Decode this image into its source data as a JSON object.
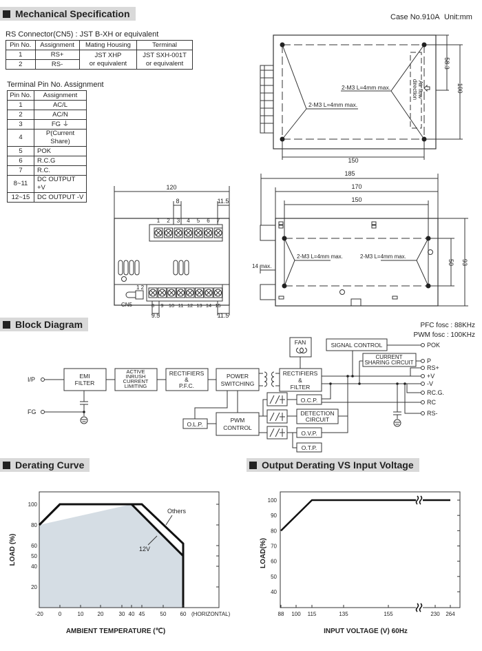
{
  "headings": {
    "mechanical": "Mechanical Specification",
    "block": "Block Diagram",
    "derating": "Derating Curve",
    "output_derating": "Output Derating VS Input Voltage"
  },
  "case_info": {
    "case_no": "Case No.910A",
    "unit": "Unit:mm"
  },
  "rs_connector": {
    "title": "RS Connector(CN5) : JST B-XH or equivalent",
    "headers": [
      "Pin No.",
      "Assignment",
      "Mating Housing",
      "Terminal"
    ],
    "rows": [
      [
        "1",
        "RS+"
      ],
      [
        "2",
        "RS-"
      ]
    ],
    "housing": [
      "JST XHP",
      "or equivalent"
    ],
    "terminal": [
      "JST SXH-001T",
      "or equivalent"
    ]
  },
  "terminal_pins": {
    "title": "Terminal Pin No.  Assignment",
    "headers": [
      "Pin No.",
      "Assignment"
    ],
    "rows": [
      [
        "1",
        "AC/L"
      ],
      [
        "2",
        "AC/N"
      ],
      [
        "3",
        "FG ⏚"
      ],
      [
        "4",
        "P(Current Share)"
      ],
      [
        "5",
        "POK"
      ],
      [
        "6",
        "R.C.G"
      ],
      [
        "7",
        "R.C."
      ],
      [
        "8~11",
        "DC OUTPUT +V"
      ],
      [
        "12~15",
        "DC OUTPUT -V"
      ]
    ]
  },
  "drawing": {
    "screw_label": "2-M3 L=4mm max.",
    "airflow": [
      "Air flow",
      "direction"
    ],
    "top_dims": {
      "width": "150",
      "d58": "58.3",
      "d100": "100"
    },
    "front_dims": {
      "width": "120",
      "pitch": "8",
      "edge": "11.5",
      "pitch_bottom": "9.5",
      "edge_bottom": "11.5"
    },
    "front_top_pins": [
      "1",
      "2",
      "3",
      "4",
      "5",
      "6",
      "7"
    ],
    "front_bottom_pins": [
      "8",
      "9",
      "10",
      "11",
      "12",
      "13",
      "14",
      "15"
    ],
    "cn5_pins": "1 2",
    "cn5_label": "CN5",
    "side_dims": {
      "d185": "185",
      "d170": "170",
      "d150": "150",
      "d14": "14 max.",
      "d50": "50",
      "d93": "93"
    }
  },
  "block_diagram": {
    "pfc": "PFC fosc : 88KHz",
    "pwm": "PWM fosc : 100KHz",
    "blocks": {
      "emi": [
        "EMI",
        "FILTER"
      ],
      "inrush": [
        "ACTIVE",
        "INRUSH",
        "CURRENT",
        "LIMITING"
      ],
      "pfc": [
        "RECTIFIERS",
        "&",
        "P.F.C."
      ],
      "switching": [
        "POWER",
        "SWITCHING"
      ],
      "rect_filter": [
        "RECTIFIERS",
        "&",
        "FILTER"
      ],
      "fan": "FAN",
      "signal": "SIGNAL CONTROL",
      "sharing": [
        "CURRENT",
        "SHARING CIRCUIT"
      ],
      "ocp": "O.C.P.",
      "detection": [
        "DETECTION",
        "CIRCUIT"
      ],
      "ovp": "O.V.P.",
      "otp": "O.T.P.",
      "olp": "O.L.P.",
      "pwm_control": [
        "PWM",
        "CONTROL"
      ]
    },
    "inputs": {
      "ip": "I/P",
      "fg": "FG"
    },
    "outputs": {
      "pok": "POK",
      "p": "P",
      "rsp": "RS+",
      "vp": "+V",
      "vn": "-V",
      "rcg": "RC.G.",
      "rc": "RC",
      "rsn": "RS-"
    }
  },
  "chart_data": [
    {
      "type": "area",
      "xlabel": "AMBIENT TEMPERATURE (℃)",
      "ylabel": "LOAD (%)",
      "x_ticks": [
        "-20",
        "0",
        "10",
        "20",
        "30",
        "40",
        "45",
        "50",
        "60"
      ],
      "x_suffix": "(HORIZONTAL)",
      "y_ticks": [
        "100",
        "80",
        "60",
        "50",
        "40",
        "20"
      ],
      "xlim": [
        -20,
        80
      ],
      "ylim": [
        0,
        112
      ],
      "fill_color": "#d5dde4",
      "series": [
        {
          "name": "Others",
          "points": [
            [
              -20,
              80
            ],
            [
              0,
              100
            ],
            [
              45,
              100
            ],
            [
              60,
              62
            ],
            [
              60,
              0
            ]
          ]
        },
        {
          "name": "12V",
          "points": [
            [
              -20,
              80
            ],
            [
              0,
              100
            ],
            [
              40,
              100
            ],
            [
              60,
              50
            ],
            [
              60,
              0
            ]
          ]
        }
      ]
    },
    {
      "type": "line",
      "xlabel": "INPUT VOLTAGE (V) 60Hz",
      "ylabel": "LOAD(%)",
      "x_ticks": [
        "88",
        "100",
        "115",
        "135",
        "155",
        "230",
        "264"
      ],
      "x_axis_break": true,
      "y_ticks": [
        "100",
        "90",
        "80",
        "70",
        "60",
        "50",
        "40"
      ],
      "ylim": [
        30,
        105
      ],
      "series": [
        {
          "points": [
            [
              88,
              80
            ],
            [
              115,
              100
            ],
            [
              264,
              100
            ]
          ]
        }
      ]
    }
  ]
}
